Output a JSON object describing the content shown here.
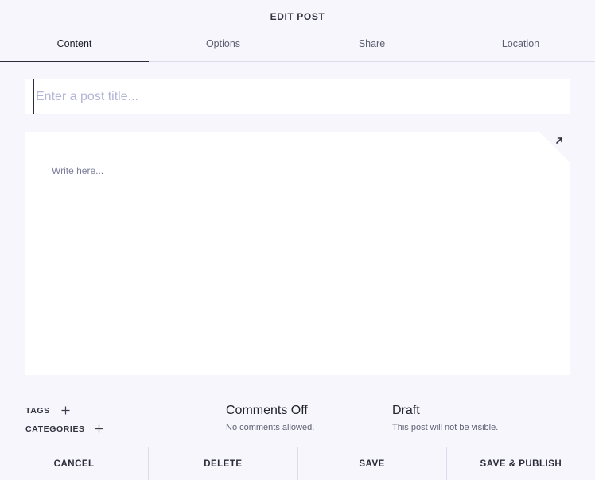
{
  "header": {
    "title": "EDIT POST"
  },
  "tabs": [
    {
      "label": "Content",
      "active": true
    },
    {
      "label": "Options",
      "active": false
    },
    {
      "label": "Share",
      "active": false
    },
    {
      "label": "Location",
      "active": false
    }
  ],
  "post": {
    "title_value": "",
    "title_placeholder": "Enter a post title...",
    "body_placeholder": "Write here..."
  },
  "editor": {
    "expand_icon": "expand-arrow-icon"
  },
  "meta": {
    "tags_label": "TAGS",
    "categories_label": "CATEGORIES",
    "comments_title": "Comments Off",
    "comments_sub": "No comments allowed.",
    "status_title": "Draft",
    "status_sub": "This post will not be visible."
  },
  "footer": {
    "cancel_label": "CANCEL",
    "delete_label": "DELETE",
    "save_label": "SAVE",
    "publish_label": "SAVE & PUBLISH"
  },
  "colors": {
    "background": "#f6f6fc",
    "surface": "#ffffff",
    "placeholder": "#b3b5d6",
    "text": "#2c2c3a"
  }
}
